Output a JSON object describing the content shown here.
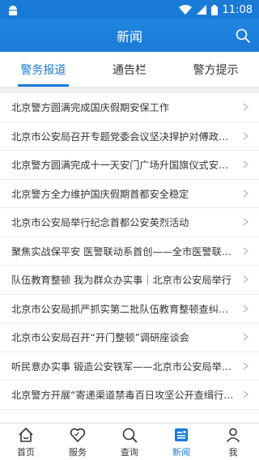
{
  "status": {
    "time": "11:08"
  },
  "header": {
    "title": "新闻"
  },
  "tabs": [
    {
      "label": "警务报道",
      "active": true
    },
    {
      "label": "通告栏",
      "active": false
    },
    {
      "label": "警方提示",
      "active": false
    }
  ],
  "news": [
    "北京警方圆满完成国庆假期安保工作",
    "北京市公安局召开专题党委会议坚决捍护对傅政华严重违纪违法问题进行审查调查的决定",
    "北京警方圆满完成十一天安门广场升国旗仪式安保工作",
    "北京警方全力维护国庆假期首都安全稳定",
    "北京市公安局举行纪念首都公安英烈活动",
    "聚焦实战保平安 医警联动系首创——全市医警联动应急处置演练",
    "队伍教育整顿 我为群众办实事｜北京市公安局举行",
    "北京市公安局抓严抓实第二批队伍教育整顿查纠整改",
    "北京市公安局召开“开门整顿”调研座谈会",
    "听民意办实事 锻造公安铁军——北京市公安局举办第二期",
    "北京警方开展“寄递渠道禁毒百日攻坚公开查缉行动”"
  ],
  "bottom_nav": [
    {
      "label": "首页",
      "icon": "home-icon",
      "active": false
    },
    {
      "label": "服务",
      "icon": "heart-icon",
      "active": false
    },
    {
      "label": "查询",
      "icon": "search-icon",
      "active": false
    },
    {
      "label": "新闻",
      "icon": "news-icon",
      "active": true
    },
    {
      "label": "我",
      "icon": "person-icon",
      "active": false
    }
  ],
  "colors": {
    "primary": "#1a7bd6"
  }
}
